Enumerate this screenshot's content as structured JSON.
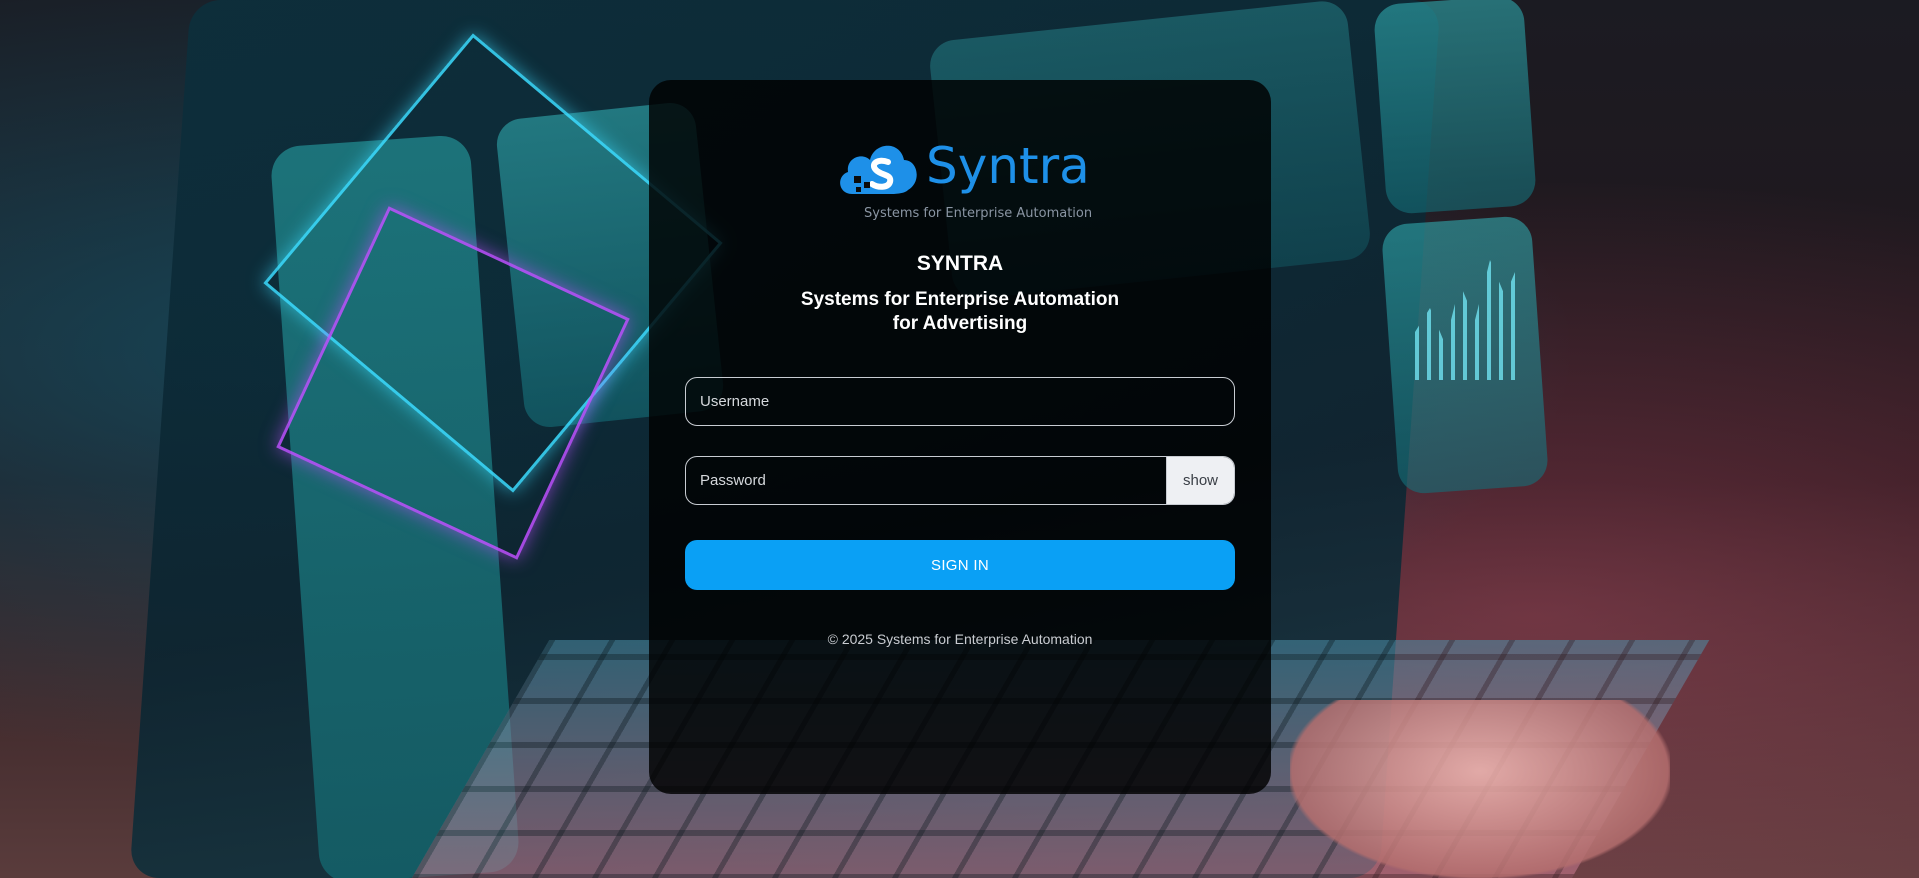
{
  "brand": {
    "logo_word": "Syntra",
    "logo_tagline": "Systems for Enterprise Automation",
    "accent_color": "#1e90e8"
  },
  "login": {
    "title": "SYNTRA",
    "subtitle_line1": "Systems for Enterprise Automation",
    "subtitle_line2": "for Advertising",
    "username_placeholder": "Username",
    "password_placeholder": "Password",
    "show_label": "show",
    "signin_label": "SIGN IN",
    "button_color": "#0aa0f5"
  },
  "footer": {
    "copyright": "© 2025 Systems for Enterprise Automation"
  }
}
